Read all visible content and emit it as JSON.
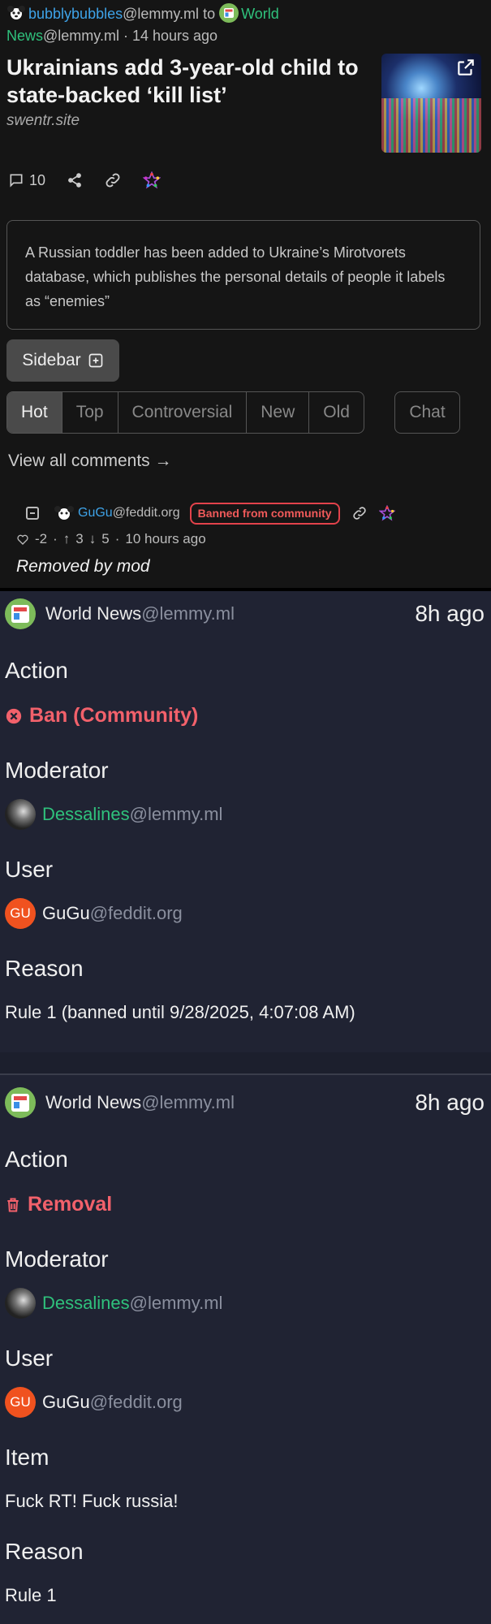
{
  "post": {
    "author": "bubblybubbles",
    "author_instance": "@lemmy.ml",
    "to": "to",
    "community": "World News",
    "community_instance": "@lemmy.ml",
    "time": "· 14 hours ago",
    "title": "Ukrainians add 3-year-old child to state-backed ‘kill list’",
    "domain": "swentr.site",
    "comment_count": "10",
    "body": "A Russian toddler has been added to Ukraine’s Mirotvorets database, which publishes the personal details of people it labels as “enemies”"
  },
  "controls": {
    "sidebar_label": "Sidebar",
    "sorts": [
      "Hot",
      "Top",
      "Controversial",
      "New",
      "Old"
    ],
    "active_sort": "Hot",
    "chat_label": "Chat",
    "view_all": "View all comments →"
  },
  "comment": {
    "author": "GuGu",
    "author_instance": "@feddit.org",
    "badge": "Banned from community",
    "score": "-2",
    "up": "3",
    "down": "5",
    "time": "10 hours ago",
    "status": "Removed by mod"
  },
  "modlog": [
    {
      "community": "World News",
      "community_instance": "@lemmy.ml",
      "time": "8h ago",
      "action_label": "Action",
      "action": "Ban (Community)",
      "action_icon": "x-circle-icon",
      "moderator_label": "Moderator",
      "moderator": "Dessalines",
      "moderator_instance": "@lemmy.ml",
      "user_label": "User",
      "user": "GuGu",
      "user_instance": "@feddit.org",
      "user_initials": "GU",
      "reason_label": "Reason",
      "reason": "Rule 1 (banned until 9/28/2025, 4:07:08 AM)"
    },
    {
      "community": "World News",
      "community_instance": "@lemmy.ml",
      "time": "8h ago",
      "action_label": "Action",
      "action": "Removal",
      "action_icon": "trash-icon",
      "moderator_label": "Moderator",
      "moderator": "Dessalines",
      "moderator_instance": "@lemmy.ml",
      "user_label": "User",
      "user": "GuGu",
      "user_instance": "@feddit.org",
      "user_initials": "GU",
      "item_label": "Item",
      "item": "Fuck RT! Fuck russia!",
      "reason_label": "Reason",
      "reason": "Rule 1"
    }
  ],
  "colors": {
    "link": "#3ea3e8",
    "community": "#2fc17c",
    "danger": "#f2616b",
    "log_bg": "#202333"
  }
}
